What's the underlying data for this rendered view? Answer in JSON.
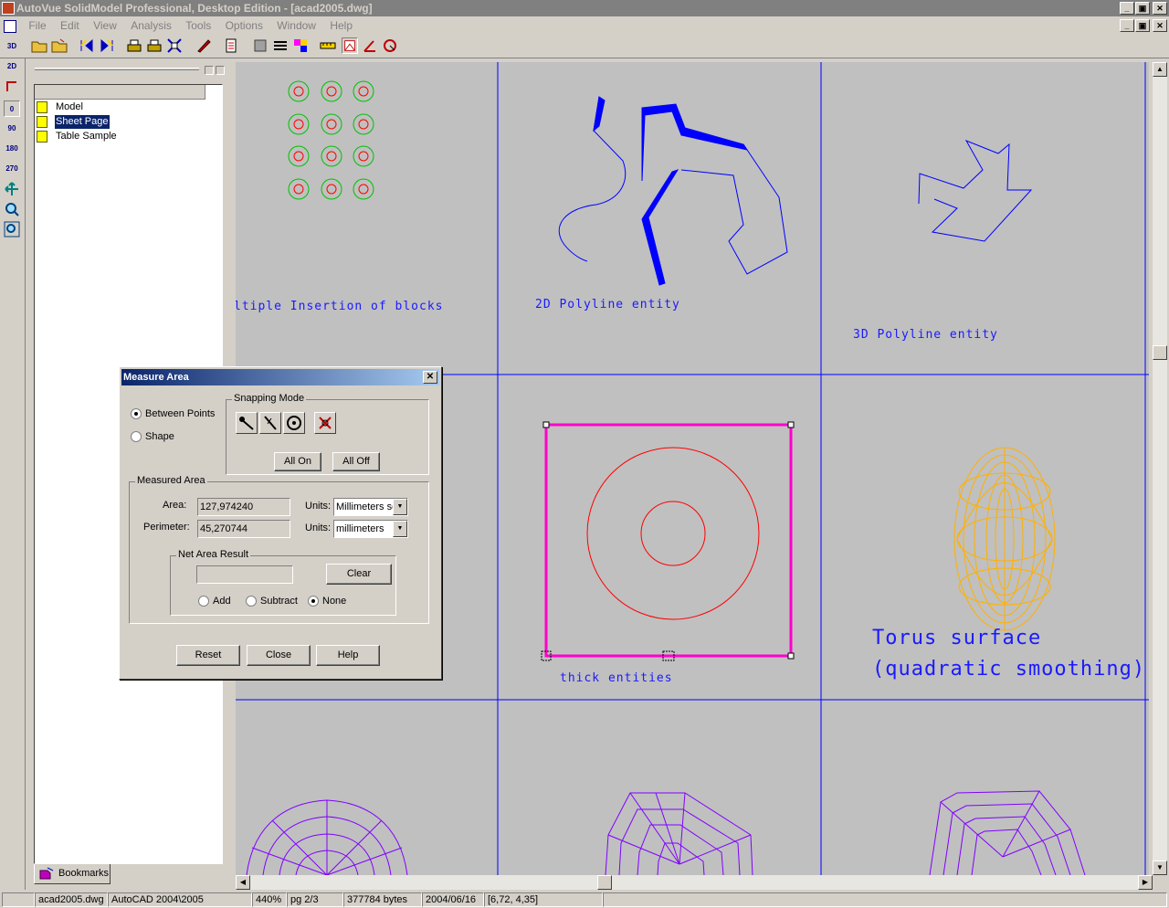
{
  "window": {
    "title": "AutoVue SolidModel Professional, Desktop Edition - [acad2005.dwg]",
    "minimize": "_",
    "restore": "▣",
    "close": "✕"
  },
  "menu": [
    "File",
    "Edit",
    "View",
    "Analysis",
    "Tools",
    "Options",
    "Window",
    "Help"
  ],
  "left_tools": [
    "3D",
    "2D",
    "0",
    "90",
    "180",
    "270"
  ],
  "bookmarks": {
    "items": [
      {
        "label": "Model",
        "selected": false
      },
      {
        "label": "Sheet Page",
        "selected": true
      },
      {
        "label": "Table Sample",
        "selected": false
      }
    ],
    "tab_label": "Bookmarks"
  },
  "drawing": {
    "labels": {
      "multiple_insertion": "ltiple Insertion of blocks",
      "polyline_2d": "2D Polyline entity",
      "polyline_3d": "3D Polyline entity",
      "thick_entities": "thick entities",
      "torus_line1": "Torus surface",
      "torus_line2": "(quadratic smoothing)"
    },
    "colors": {
      "background": "#c0c0c0",
      "grid": "#0000ff",
      "selection": "#ff00cc",
      "circle_red": "#ff0000",
      "circle_green": "#00c000",
      "torus": "#ffb000",
      "mesh": "#8000ff"
    }
  },
  "dialog": {
    "title": "Measure Area",
    "mode_between_points": "Between Points",
    "mode_shape": "Shape",
    "snapping_mode": "Snapping Mode",
    "all_on": "All On",
    "all_off": "All Off",
    "measured_area": "Measured Area",
    "area_label": "Area:",
    "area_value": "127,974240",
    "perimeter_label": "Perimeter:",
    "perimeter_value": "45,270744",
    "units_label": "Units:",
    "area_units": "Millimeters sq",
    "perimeter_units": "millimeters",
    "net_area_result": "Net Area Result",
    "net_area_value": "",
    "clear": "Clear",
    "add": "Add",
    "subtract": "Subtract",
    "none": "None",
    "reset": "Reset",
    "close": "Close",
    "help": "Help"
  },
  "status": {
    "file": "acad2005.dwg",
    "format": "AutoCAD 2004\\2005",
    "zoom": "440%",
    "page": "pg 2/3",
    "size": "377784 bytes",
    "date": "2004/06/16",
    "coords": "[6,72, 4,35]"
  }
}
